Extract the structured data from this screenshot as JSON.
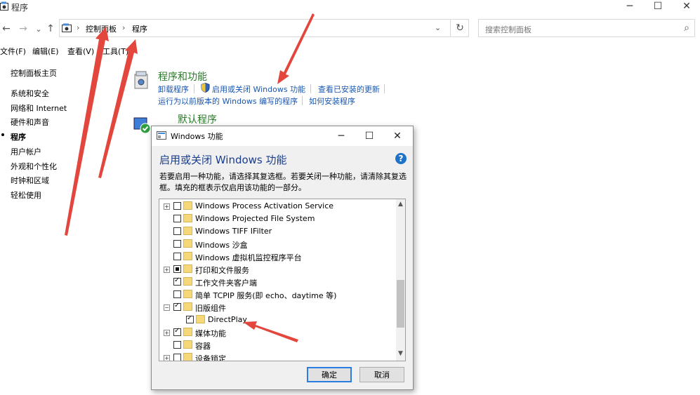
{
  "window": {
    "title": "程序",
    "minimize_icon": "─",
    "maximize_icon": "☐",
    "close_icon": "✕"
  },
  "nav_buttons": {
    "back": "←",
    "forward": "→",
    "recent": "⌄",
    "up": "↑"
  },
  "address": {
    "crumbs": [
      "控制面板",
      "程序"
    ],
    "separator": "›",
    "dropdown": "⌄",
    "refresh": "↻"
  },
  "search": {
    "placeholder": "搜索控制面板",
    "icon": "⌕"
  },
  "menu": [
    "文件(F)",
    "编辑(E)",
    "查看(V)",
    "工具(T)"
  ],
  "sidebar": {
    "home": "控制面板主页",
    "items": [
      "系统和安全",
      "网络和 Internet",
      "硬件和声音",
      "程序",
      "用户帐户",
      "外观和个性化",
      "时钟和区域",
      "轻松使用"
    ],
    "selected_index": 3
  },
  "programs": {
    "title": "程序和功能",
    "links_row1": [
      "卸载程序",
      "启用或关闭 Windows 功能",
      "查看已安装的更新"
    ],
    "links_row2": [
      "运行为以前版本的 Windows 编写的程序",
      "如何安装程序"
    ]
  },
  "default_programs": {
    "title": "默认程序"
  },
  "dialog": {
    "title": "Windows 功能",
    "minimize_icon": "─",
    "maximize_icon": "☐",
    "close_icon": "✕",
    "heading": "启用或关闭 Windows 功能",
    "help_icon": "?",
    "description": "若要启用一种功能，请选择其复选框。若要关闭一种功能，请清除其复选框。填充的框表示仅启用该功能的一部分。",
    "features": [
      {
        "label": "Windows Process Activation Service",
        "state": "unchecked",
        "expander": "+",
        "level": 0
      },
      {
        "label": "Windows Projected File System",
        "state": "unchecked",
        "expander": "",
        "level": 0
      },
      {
        "label": "Windows TIFF IFilter",
        "state": "unchecked",
        "expander": "",
        "level": 0
      },
      {
        "label": "Windows 沙盒",
        "state": "unchecked",
        "expander": "",
        "level": 0
      },
      {
        "label": "Windows 虚拟机监控程序平台",
        "state": "unchecked",
        "expander": "",
        "level": 0
      },
      {
        "label": "打印和文件服务",
        "state": "partial",
        "expander": "+",
        "level": 0
      },
      {
        "label": "工作文件夹客户端",
        "state": "checked",
        "expander": "",
        "level": 0
      },
      {
        "label": "简单 TCPIP 服务(即 echo、daytime 等)",
        "state": "unchecked",
        "expander": "",
        "level": 0
      },
      {
        "label": "旧版组件",
        "state": "checked",
        "expander": "−",
        "level": 0
      },
      {
        "label": "DirectPlay",
        "state": "checked",
        "expander": "",
        "level": 1
      },
      {
        "label": "媒体功能",
        "state": "checked",
        "expander": "+",
        "level": 0
      },
      {
        "label": "容器",
        "state": "unchecked",
        "expander": "",
        "level": 0
      },
      {
        "label": "设备锁定",
        "state": "unchecked",
        "expander": "+",
        "level": 0
      }
    ],
    "scroll_up": "▲",
    "scroll_down": "▼",
    "ok_label": "确定",
    "cancel_label": "取消"
  },
  "colors": {
    "arrow": "#e3463c",
    "link": "#1a56b0",
    "section_title": "#2a7a2a",
    "dialog_heading": "#1a3d8c"
  }
}
